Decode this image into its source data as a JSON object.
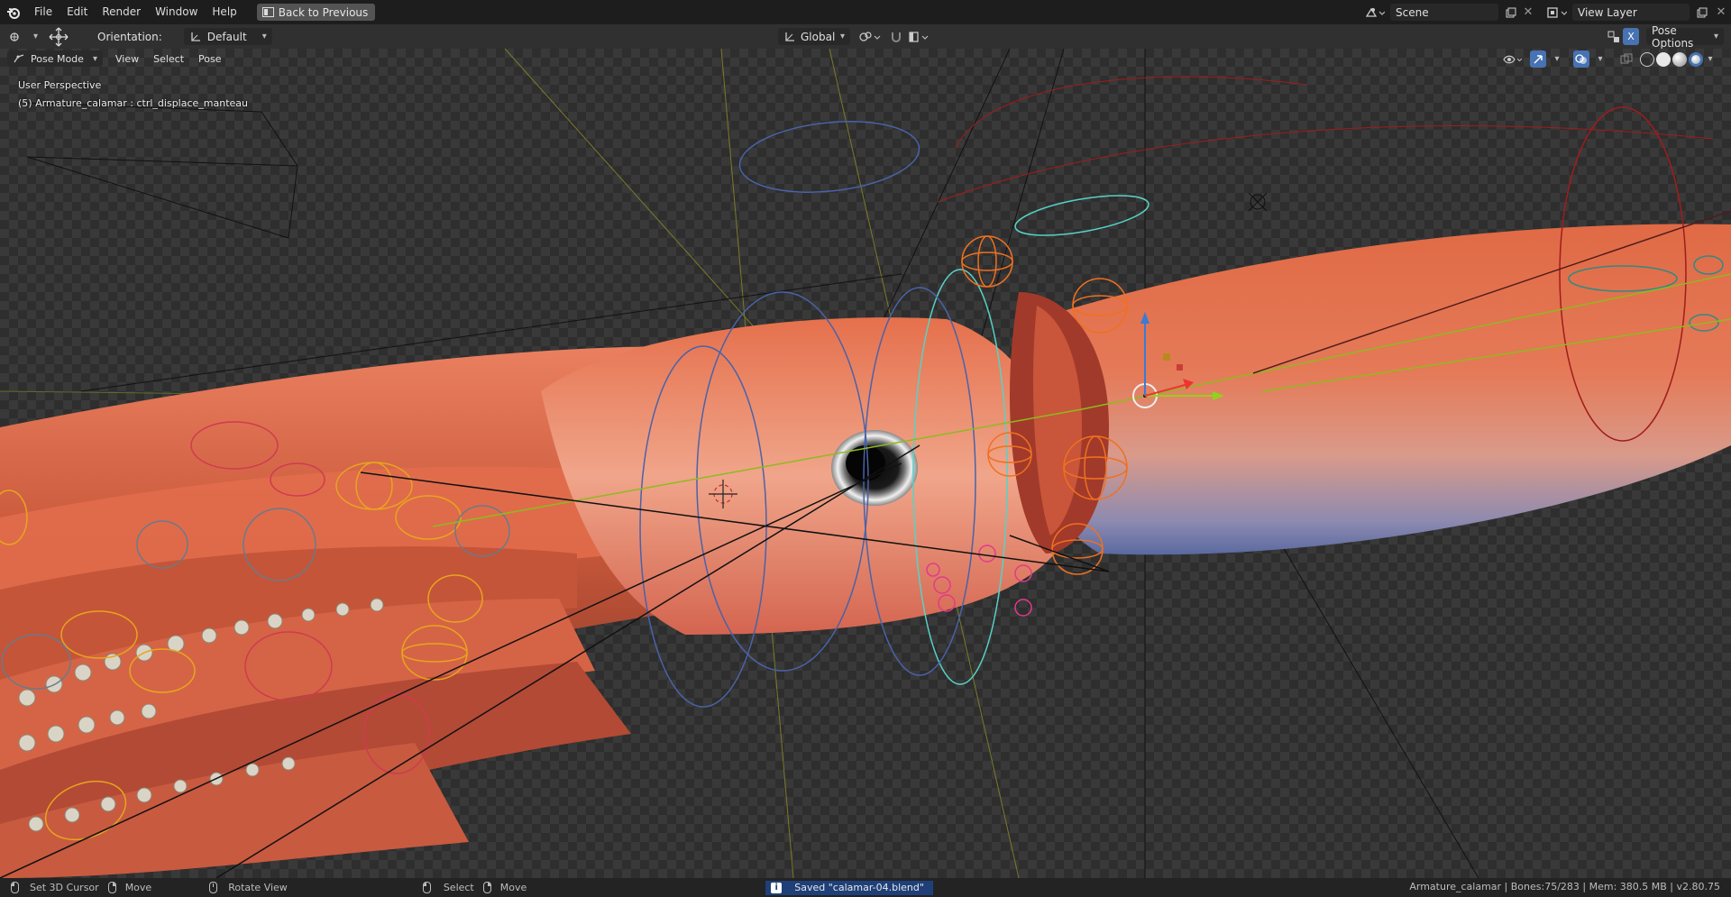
{
  "topbar": {
    "menus": [
      "File",
      "Edit",
      "Render",
      "Window",
      "Help"
    ],
    "back_button": "Back to Previous",
    "scene": "Scene",
    "view_layer": "View Layer"
  },
  "toolbar": {
    "orientation_label": "Orientation:",
    "orientation_value": "Default",
    "transform_space": "Global",
    "pose_options": "Pose Options",
    "x_mirror": "X"
  },
  "viewport_header": {
    "mode": "Pose Mode",
    "menus": [
      "View",
      "Select",
      "Pose"
    ]
  },
  "overlay": {
    "view_name": "User Perspective",
    "active_object": "(5) Armature_calamar : ctrl_displace_manteau"
  },
  "statusbar": {
    "set_cursor": "Set 3D Cursor",
    "move1": "Move",
    "rotate_view": "Rotate View",
    "select": "Select",
    "move2": "Move",
    "saved_message": "Saved \"calamar-04.blend\"",
    "stats": "Armature_calamar | Bones:75/283 | Mem: 380.5 MB | v2.80.75"
  },
  "icons": {
    "app_logo": "blender-logo-icon",
    "back": "screen-back-icon",
    "editor_type": "3d-viewport-icon",
    "transform_gizmo": "transform-pivot-icon",
    "mode": "pose-mode-icon",
    "visibility": "eye-icon",
    "gizmo": "gizmo-icon",
    "overlays": "overlays-icon",
    "xray": "xray-icon",
    "shading_wire": "wireframe-shading-icon",
    "shading_solid": "solid-shading-icon",
    "shading_material": "material-shading-icon",
    "shading_rendered": "rendered-shading-icon",
    "snap": "snap-icon",
    "proportional": "proportional-edit-icon"
  },
  "colors": {
    "squid_body": "#d85a32",
    "squid_highlight": "#f2a98b",
    "status_saved_bg": "#1f3f78",
    "active_blue": "#4772b3"
  }
}
